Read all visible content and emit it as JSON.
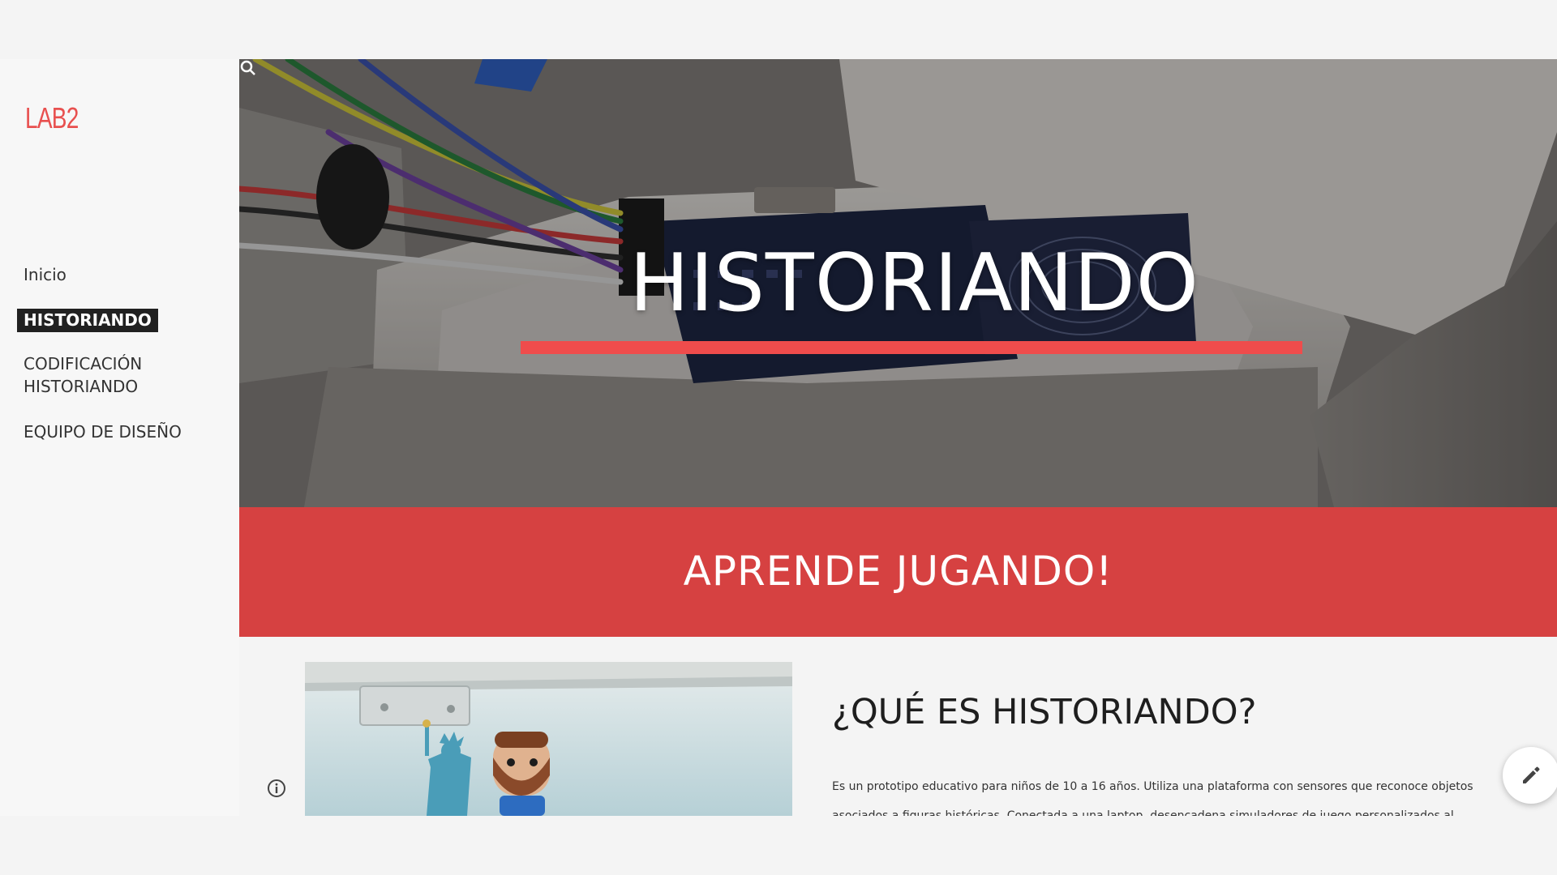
{
  "site": {
    "logo": "LAB2"
  },
  "nav": {
    "items": [
      {
        "label": "Inicio",
        "active": false
      },
      {
        "label": "HISTORIANDO",
        "active": true
      },
      {
        "label": "CODIFICACIÓN",
        "label2": "HISTORIANDO",
        "active": false
      },
      {
        "label": "EQUIPO DE DISEÑO",
        "active": false
      }
    ]
  },
  "hero": {
    "title": "HISTORIANDO",
    "accent_color": "#ef4c4c"
  },
  "banner": {
    "text": "APRENDE JUGANDO!",
    "color": "#d64141"
  },
  "section": {
    "title": "¿QUÉ ES HISTORIANDO?",
    "body_line1": "Es un prototipo educativo para niños de 10 a 16 años. Utiliza una plataforma con sensores que reconoce objetos",
    "body_line2": "asociados a figuras históricas. Conectada a una laptop, desencadena simuladores de juego personalizados al"
  },
  "icons": {
    "info": "info-icon",
    "edit": "pencil-icon",
    "hero_corner": "search-icon"
  }
}
